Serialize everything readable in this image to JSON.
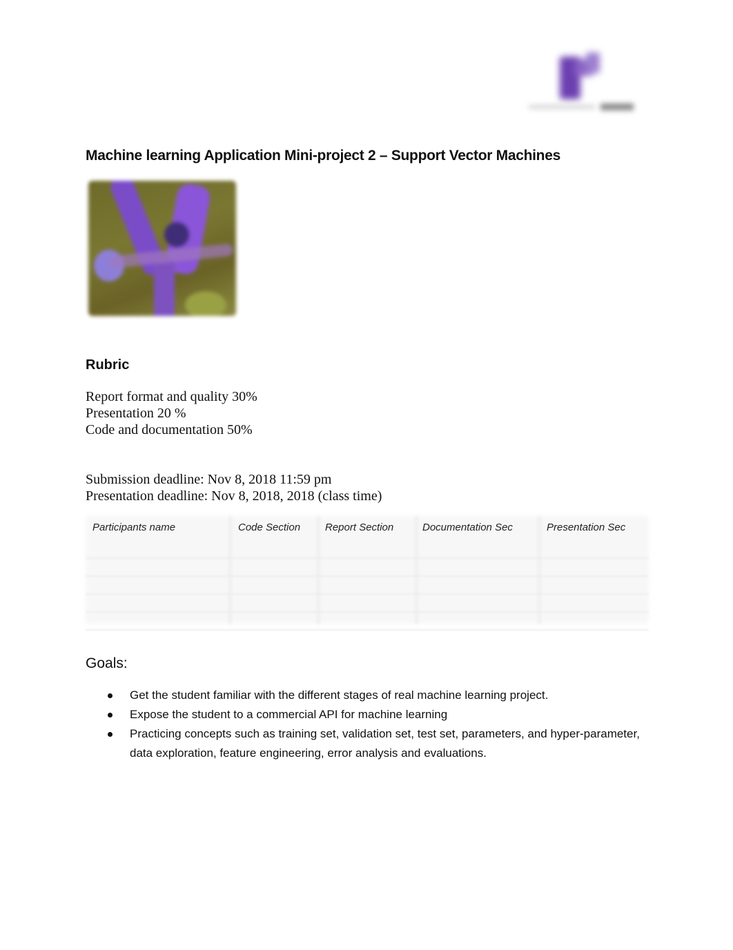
{
  "document": {
    "logo": "university-logo",
    "title": "Machine learning Application Mini-project 2 – Support Vector Machines",
    "image": "iris-flower-photo",
    "rubric": {
      "heading": "Rubric",
      "items": [
        "Report format and quality 30%",
        "Presentation 20 %",
        "Code and documentation 50%"
      ]
    },
    "deadlines": [
      "Submission deadline: Nov 8, 2018 11:59 pm",
      "Presentation deadline: Nov 8, 2018, 2018 (class time)"
    ],
    "participants_table": {
      "headers": [
        "Participants name",
        "Code Section",
        "Report Section",
        "Documentation Sec",
        "Presentation Sec"
      ],
      "rows": [
        [
          "",
          "",
          "",
          "",
          ""
        ],
        [
          "",
          "",
          "",
          "",
          ""
        ],
        [
          "",
          "",
          "",
          "",
          ""
        ],
        [
          "",
          "",
          "",
          "",
          ""
        ],
        [
          "",
          "",
          "",
          "",
          ""
        ]
      ]
    },
    "goals": {
      "heading": "Goals:",
      "items": [
        "Get the student familiar with the different stages of real machine learning project.",
        "Expose the student to a commercial API for machine learning",
        "Practicing concepts such as training set, validation set, test set, parameters, and hyper-parameter, data exploration, feature engineering, error analysis and evaluations."
      ]
    }
  },
  "colors": {
    "logo_purple": "#6c3fb0",
    "text": "#111111"
  }
}
